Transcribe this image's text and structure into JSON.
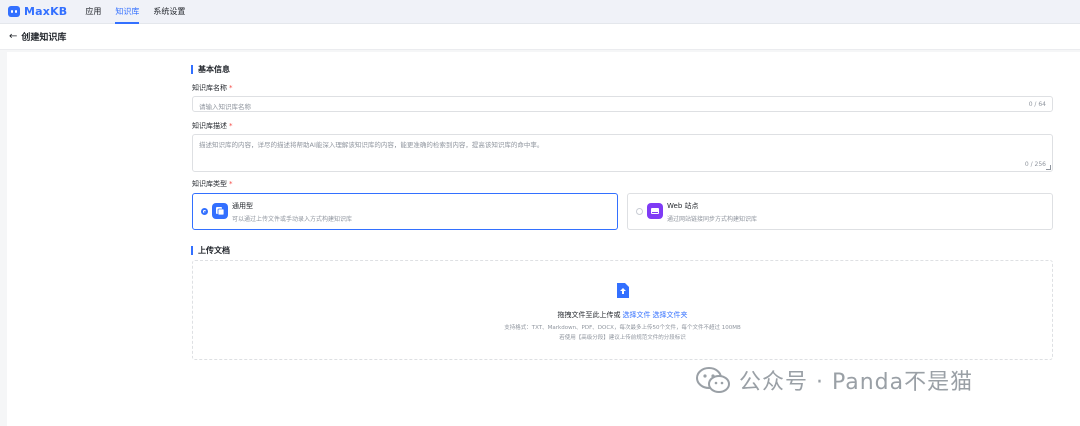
{
  "app": {
    "brand": "MaxKB"
  },
  "nav": {
    "items": [
      {
        "label": "应用",
        "active": false
      },
      {
        "label": "知识库",
        "active": true
      },
      {
        "label": "系统设置",
        "active": false
      }
    ]
  },
  "header": {
    "back_icon": "←",
    "title": "创建知识库"
  },
  "basic_info": {
    "title": "基本信息",
    "name_label": "知识库名称",
    "name_placeholder": "请输入知识库名称",
    "name_count": "0 / 64",
    "desc_label": "知识库描述",
    "desc_placeholder": "描述知识库的内容，详尽的描述将帮助AI能深入理解该知识库的内容，能更准确的检索到内容，提高该知识库的命中率。",
    "desc_count": "0 / 256",
    "required_mark": "*",
    "type_label": "知识库类型",
    "types": [
      {
        "title": "通用型",
        "desc": "可以通过上传文件或手动录入方式构建知识库",
        "selected": true,
        "color": "#3370ff",
        "icon": "document-icon"
      },
      {
        "title": "Web 站点",
        "desc": "通过网站链接同步方式构建知识库",
        "selected": false,
        "color": "#7f3bf5",
        "icon": "web-icon"
      }
    ]
  },
  "upload": {
    "title": "上传文档",
    "main_text": "拖拽文件至此上传或",
    "select_file": "选择文件",
    "select_folder": "选择文件夹",
    "formats": "支持格式：TXT、Markdown、PDF、DOCX，每次最多上传50个文件，每个文件不超过 100MB",
    "advice": "若使用【高级分段】建议上传前规范文件的分段标识"
  },
  "watermark": {
    "text": "公众号 · Panda不是猫"
  },
  "colors": {
    "accent": "#3370ff",
    "purple": "#7f3bf5",
    "required": "#f54a45"
  }
}
